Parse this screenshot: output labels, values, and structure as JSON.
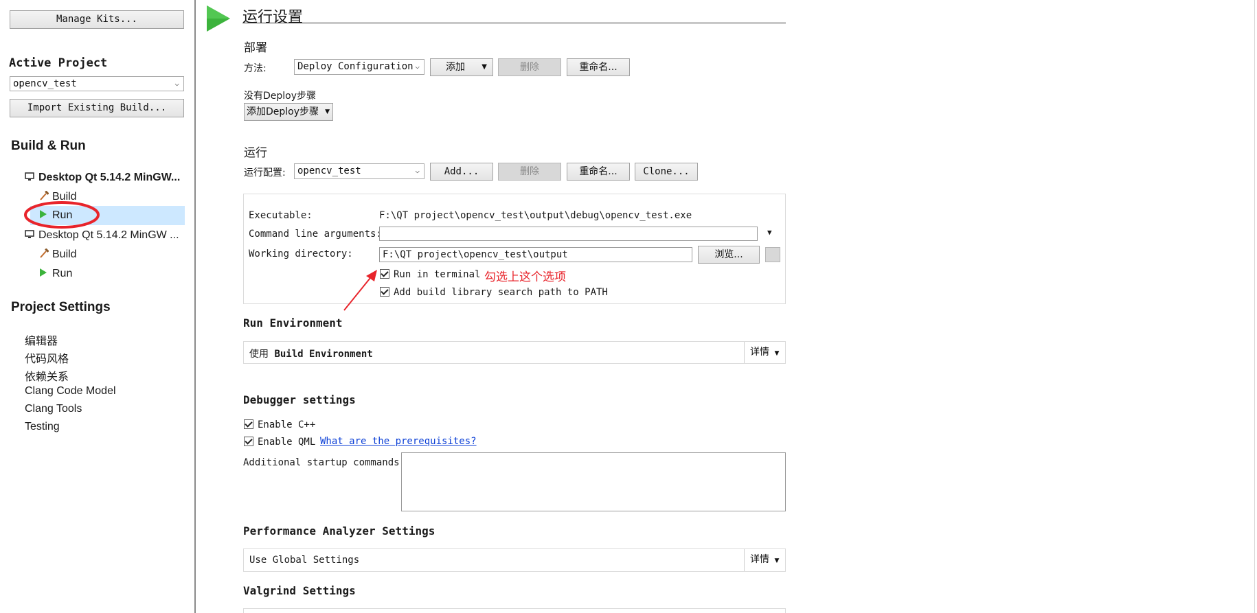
{
  "sidebar": {
    "manage_kits": "Manage Kits...",
    "active_project_label": "Active Project",
    "active_project_value": "opencv_test",
    "import_build": "Import Existing Build...",
    "build_run_title": "Build & Run",
    "kits": [
      {
        "name": "Desktop Qt 5.14.2 MinGW...",
        "build": "Build",
        "run": "Run"
      },
      {
        "name": "Desktop Qt 5.14.2 MinGW ...",
        "build": "Build",
        "run": "Run"
      }
    ],
    "project_settings_title": "Project Settings",
    "project_settings_items": [
      "编辑器",
      "代码风格",
      "依赖关系",
      "Clang Code Model",
      "Clang Tools",
      "Testing"
    ]
  },
  "main": {
    "page_title": "运行设置",
    "deploy": {
      "heading": "部署",
      "method_label": "方法:",
      "config_value": "Deploy Configuration",
      "add": "添加",
      "delete": "删除",
      "rename": "重命名...",
      "no_steps": "没有Deploy步骤",
      "add_step": "添加Deploy步骤"
    },
    "run": {
      "heading": "运行",
      "config_label": "运行配置:",
      "config_value": "opencv_test",
      "add": "Add...",
      "delete": "删除",
      "rename": "重命名...",
      "clone": "Clone...",
      "executable_label": "Executable:",
      "executable_value": "F:\\QT project\\opencv_test\\output\\debug\\opencv_test.exe",
      "args_label": "Command line arguments:",
      "args_value": "",
      "workdir_label": "Working directory:",
      "workdir_value": "F:\\QT project\\opencv_test\\output",
      "browse": "浏览...",
      "run_in_terminal": "Run in terminal",
      "run_in_terminal_checked": true,
      "add_lib_path": "Add build library search path to PATH",
      "add_lib_path_checked": true
    },
    "annotation": "勾选上这个选项",
    "run_env": {
      "heading": "Run Environment",
      "use_prefix": "使用",
      "use_value": "Build Environment",
      "details": "详情"
    },
    "debugger": {
      "heading": "Debugger settings",
      "enable_cpp": "Enable C++",
      "enable_qml": "Enable QML",
      "prereq_link": "What are the prerequisites?",
      "startup_label": "Additional startup commands:",
      "startup_value": ""
    },
    "perf": {
      "heading": "Performance Analyzer Settings",
      "value": "Use Global Settings",
      "details": "详情"
    },
    "valgrind": {
      "heading": "Valgrind Settings"
    }
  },
  "colors": {
    "run_green": "#3cb33c",
    "selection": "#cde8ff",
    "annotation_red": "#e8242b",
    "link_blue": "#0b3fd6"
  }
}
